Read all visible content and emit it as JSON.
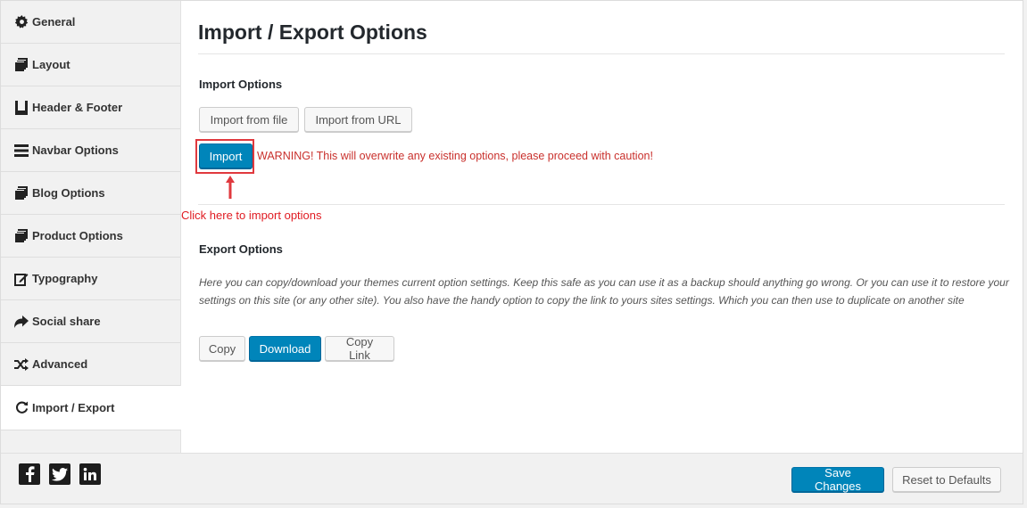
{
  "sidebar": {
    "items": [
      {
        "label": "General",
        "icon": "gear-icon"
      },
      {
        "label": "Layout",
        "icon": "copy-icon"
      },
      {
        "label": "Header & Footer",
        "icon": "header-footer-icon"
      },
      {
        "label": "Navbar Options",
        "icon": "bars-icon"
      },
      {
        "label": "Blog Options",
        "icon": "copy-icon"
      },
      {
        "label": "Product Options",
        "icon": "copy-icon"
      },
      {
        "label": "Typography",
        "icon": "edit-icon"
      },
      {
        "label": "Social share",
        "icon": "share-icon"
      },
      {
        "label": "Advanced",
        "icon": "random-icon"
      },
      {
        "label": "Import / Export",
        "icon": "refresh-icon",
        "active": true
      }
    ]
  },
  "main": {
    "title": "Import / Export Options",
    "import": {
      "heading": "Import Options",
      "from_file_label": "Import from file",
      "from_url_label": "Import from URL",
      "import_label": "Import",
      "warning": "WARNING! This will overwrite any existing options, please proceed with caution!",
      "annotation": "Click here to import options"
    },
    "export": {
      "heading": "Export Options",
      "description": "Here you can copy/download your themes current option settings. Keep this safe as you can use it as a backup should anything go wrong. Or you can use it to restore your settings on this site (or any other site). You also have the handy option to copy the link to yours sites settings. Which you can then use to duplicate on another site",
      "copy_label": "Copy",
      "download_label": "Download",
      "copy_link_label": "Copy Link"
    }
  },
  "footer": {
    "social": [
      "facebook-icon",
      "twitter-icon",
      "linkedin-icon"
    ],
    "save_label": "Save Changes",
    "reset_label": "Reset to Defaults"
  },
  "colors": {
    "primary": "#0085ba",
    "warning": "#c9302c",
    "annotation": "#e01b22",
    "sidebar_bg": "#f1f1f1"
  }
}
